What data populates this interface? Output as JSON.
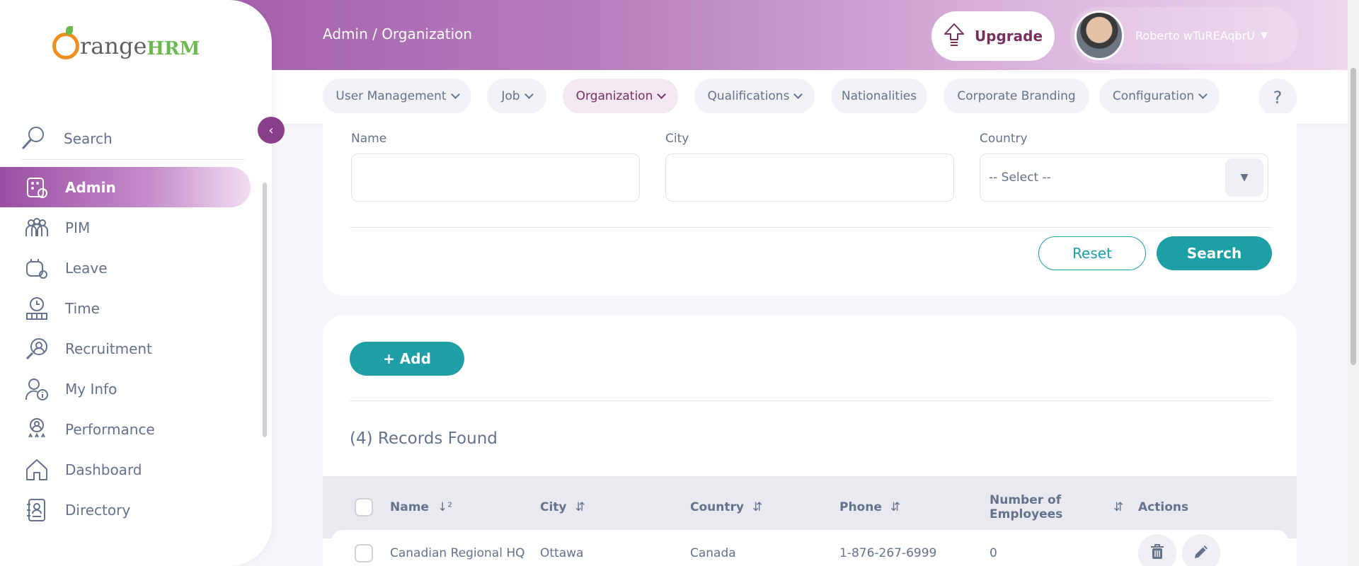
{
  "header": {
    "breadcrumb": "Admin / Organization",
    "upgrade_label": "Upgrade",
    "user_name": "Roberto wTuREAqbrU"
  },
  "subnav": {
    "items": [
      {
        "label": "User Management"
      },
      {
        "label": "Job"
      },
      {
        "label": "Organization"
      },
      {
        "label": "Qualifications"
      },
      {
        "label": "Nationalities"
      },
      {
        "label": "Corporate Branding"
      },
      {
        "label": "Configuration"
      }
    ],
    "help_label": "?"
  },
  "sidebar": {
    "logo_text": "range",
    "logo_hrm": "HRM",
    "search_label": "Search",
    "items": [
      {
        "label": "Admin",
        "icon": "admin-icon"
      },
      {
        "label": "PIM",
        "icon": "pim-icon"
      },
      {
        "label": "Leave",
        "icon": "leave-icon"
      },
      {
        "label": "Time",
        "icon": "time-icon"
      },
      {
        "label": "Recruitment",
        "icon": "recruitment-icon"
      },
      {
        "label": "My Info",
        "icon": "my-info-icon"
      },
      {
        "label": "Performance",
        "icon": "performance-icon"
      },
      {
        "label": "Dashboard",
        "icon": "dashboard-icon"
      },
      {
        "label": "Directory",
        "icon": "directory-icon"
      }
    ]
  },
  "filter": {
    "name_label": "Name",
    "name_value": "",
    "city_label": "City",
    "city_value": "",
    "country_label": "Country",
    "country_value": "-- Select --",
    "reset_label": "Reset",
    "search_label": "Search"
  },
  "records": {
    "add_label": "+ Add",
    "found_text": "(4) Records Found",
    "columns": {
      "name": "Name",
      "city": "City",
      "country": "Country",
      "phone": "Phone",
      "employees_line1": "Number of",
      "employees_line2": "Employees",
      "actions": "Actions"
    },
    "rows": [
      {
        "name": "Canadian Regional HQ",
        "city": "Ottawa",
        "country": "Canada",
        "phone": "1-876-267-6999",
        "employees": "0"
      }
    ]
  },
  "colors": {
    "brand_purple": "#9a4fa3",
    "accent_teal": "#1e9fa5",
    "text_gray": "#64728c"
  }
}
